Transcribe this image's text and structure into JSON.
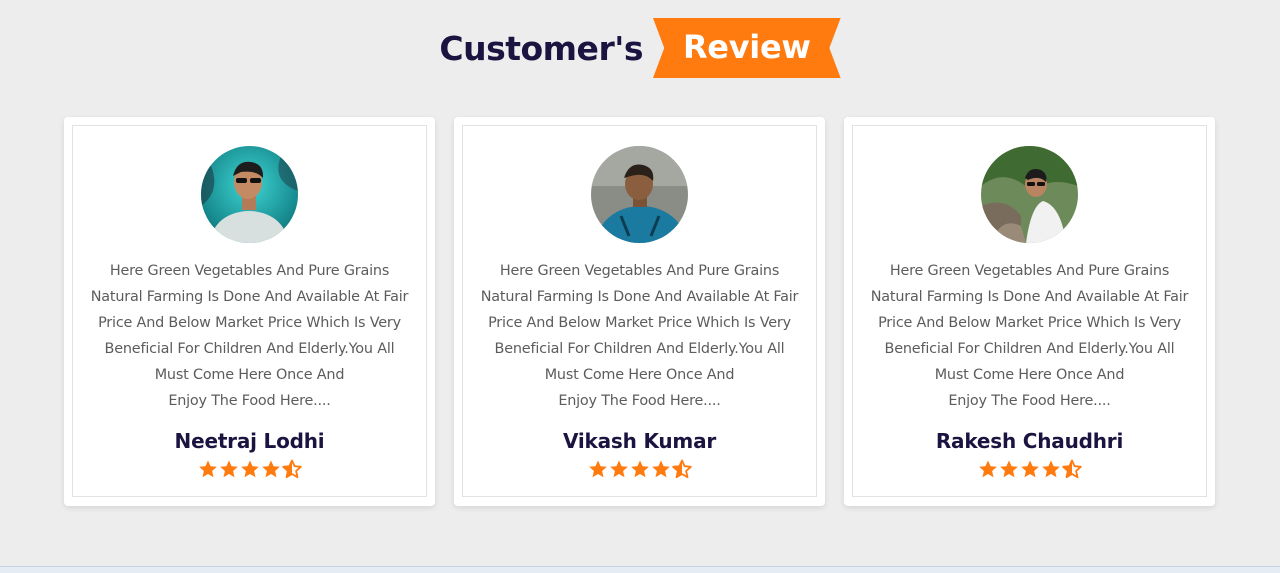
{
  "heading": {
    "prefix": "Customer's",
    "highlight": "Review",
    "highlight_color": "#ff7a0f",
    "text_color": "#1b1340"
  },
  "reviews": [
    {
      "name": "Neetraj Lodhi",
      "avatar_icon": "person-photo",
      "text_lines": [
        "Here Green Vegetables And Pure Grains",
        "Natural Farming Is Done And Available At Fair",
        "Price And Below Market Price Which Is Very",
        "Beneficial For Children And Elderly.You All",
        "Must Come Here Once And",
        "Enjoy The Food Here...."
      ],
      "rating": 4.5
    },
    {
      "name": "Vikash Kumar",
      "avatar_icon": "person-photo",
      "text_lines": [
        "Here Green Vegetables And Pure Grains",
        "Natural Farming Is Done And Available At Fair",
        "Price And Below Market Price Which Is Very",
        "Beneficial For Children And Elderly.You All",
        "Must Come Here Once And",
        "Enjoy The Food Here...."
      ],
      "rating": 4.5
    },
    {
      "name": "Rakesh Chaudhri",
      "avatar_icon": "person-photo",
      "text_lines": [
        "Here Green Vegetables And Pure Grains",
        "Natural Farming Is Done And Available At Fair",
        "Price And Below Market Price Which Is Very",
        "Beneficial For Children And Elderly.You All",
        "Must Come Here Once And",
        "Enjoy The Food Here...."
      ],
      "rating": 4.5
    }
  ],
  "star_color": "#ff7a0f"
}
